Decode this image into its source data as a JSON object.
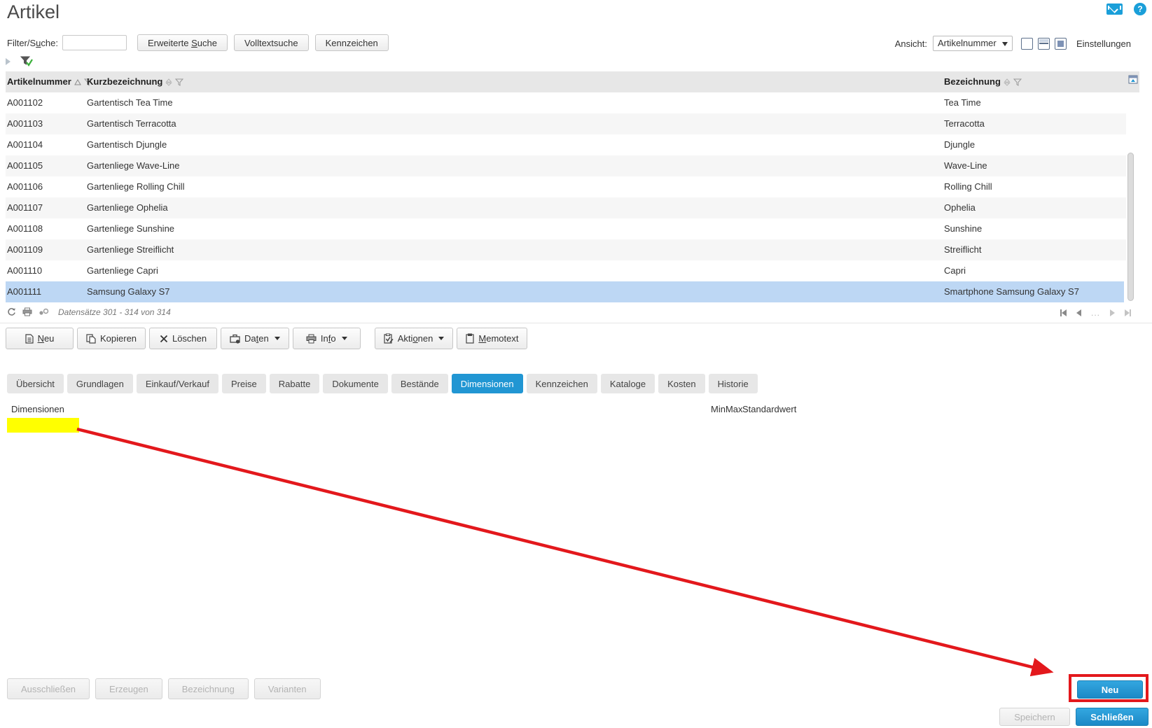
{
  "page": {
    "title": "Artikel"
  },
  "filter_bar": {
    "label": {
      "pre": "Filter/S",
      "key": "u",
      "post": "che:"
    },
    "search_value": "",
    "buttons": [
      {
        "pre": "Erweiterte ",
        "key": "S",
        "post": "uche"
      },
      {
        "pre": "",
        "key": "",
        "post": "Volltextsuche"
      },
      {
        "pre": "",
        "key": "",
        "post": "Kennzeichen"
      }
    ],
    "ansicht_label": "Ansicht:",
    "ansicht_value": "Artikelnummer",
    "einstellungen_label": "Einstellungen"
  },
  "help": {
    "glyph": "?"
  },
  "table": {
    "columns": [
      {
        "label": "Artikelnummer",
        "sort": "asc"
      },
      {
        "label": "Kurzbezeichnung",
        "sort": "none"
      },
      {
        "label": "Bezeichnung",
        "sort": "none"
      }
    ],
    "rows": [
      [
        "A001102",
        "Gartentisch Tea Time",
        "Tea Time"
      ],
      [
        "A001103",
        "Gartentisch Terracotta",
        "Terracotta"
      ],
      [
        "A001104",
        "Gartentisch Djungle",
        "Djungle"
      ],
      [
        "A001105",
        "Gartenliege Wave-Line",
        "Wave-Line"
      ],
      [
        "A001106",
        "Gartenliege Rolling Chill",
        "Rolling Chill"
      ],
      [
        "A001107",
        "Gartenliege Ophelia",
        "Ophelia"
      ],
      [
        "A001108",
        "Gartenliege Sunshine",
        "Sunshine"
      ],
      [
        "A001109",
        "Gartenliege Streiflicht",
        "Streiflicht"
      ],
      [
        "A001110",
        "Gartenliege Capri",
        "Capri"
      ],
      [
        "A001111",
        "Samsung Galaxy S7",
        "Smartphone Samsung Galaxy S7"
      ]
    ],
    "selected_row": "A001111",
    "status_text": "Datensätze 301 - 314 von 314",
    "pagination": {
      "ellipsis": "..."
    }
  },
  "toolbar": {
    "buttons": [
      {
        "pre": "",
        "key": "N",
        "post": "eu",
        "icon": "new-document-icon",
        "dropdown": false
      },
      {
        "pre": "",
        "key": "",
        "post": "Kopieren",
        "icon": "copy-icon",
        "dropdown": false
      },
      {
        "pre": "",
        "key": "",
        "post": "Löschen",
        "icon": "delete-icon",
        "dropdown": false
      },
      {
        "pre": "Da",
        "key": "t",
        "post": "en",
        "icon": "briefcase-icon",
        "dropdown": true
      },
      {
        "pre": "In",
        "key": "f",
        "post": "o",
        "icon": "printer-icon",
        "dropdown": true
      },
      {
        "pre": "Akti",
        "key": "o",
        "post": "nen",
        "icon": "actions-icon",
        "dropdown": true
      },
      {
        "pre": "",
        "key": "M",
        "post": "emotext",
        "icon": "memo-icon",
        "dropdown": false
      }
    ]
  },
  "tabs": {
    "items": [
      "Übersicht",
      "Grundlagen",
      "Einkauf/Verkauf",
      "Preise",
      "Rabatte",
      "Dokumente",
      "Bestände",
      "Dimensionen",
      "Kennzeichen",
      "Kataloge",
      "Kosten",
      "Historie"
    ],
    "active": "Dimensionen"
  },
  "dimensions_panel": {
    "title": "Dimensionen",
    "col_minmax": "MinMax",
    "col_standardwert": "Standardwert"
  },
  "footer": {
    "disabled_buttons": [
      "Ausschließen",
      "Erzeugen",
      "Bezeichnung",
      "Varianten"
    ],
    "neu_button": "Neu",
    "speichern_button": "Speichern",
    "schliessen_button": "Schließen"
  },
  "colors": {
    "accent_blue": "#2196d3",
    "selection_blue": "#bdd7f4",
    "annotation_red": "#e3181c",
    "highlight_yellow": "#ffff00",
    "icon_blue": "#1a9fd9"
  }
}
